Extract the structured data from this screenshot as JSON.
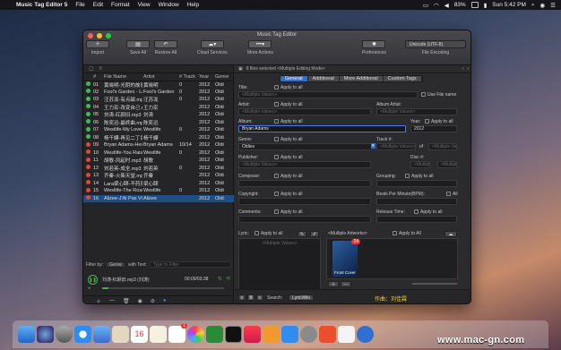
{
  "menubar": {
    "apple": "",
    "app": "Music Tag Editor 5",
    "menus": [
      "File",
      "Edit",
      "Format",
      "View",
      "Window",
      "Help"
    ],
    "battery": "83%",
    "time": "Sun 5:42 PM"
  },
  "window": {
    "title": "Music Tag Editor",
    "toolbar": [
      {
        "icon": "plus-icon",
        "label": "Import"
      },
      {
        "icon": "save-icon",
        "label": "Save All"
      },
      {
        "icon": "restore-icon",
        "label": "Restore All"
      },
      {
        "icon": "cloud-icon",
        "label": "Cloud Services"
      },
      {
        "icon": "more-icon",
        "label": "More Actions"
      },
      {
        "icon": "gear-icon",
        "label": "Preferences"
      }
    ],
    "encoding": {
      "value": "Unicode (UTF-8)",
      "label": "File Encoding"
    }
  },
  "files": {
    "columns": [
      "#",
      "File Name",
      "Artist",
      "# Track",
      "Year",
      "Genre"
    ],
    "rows": [
      [
        "01",
        "黄晓明-光阴的故事.",
        "黄晓明",
        "0",
        "2012",
        "Oldi",
        "#3bbf5a"
      ],
      [
        "02",
        "Fool's Garden - Le.",
        "Fool's Garden",
        "0",
        "2012",
        "Oldi",
        "#3bbf5a"
      ],
      [
        "03",
        "汪苏泷-有点甜.mp3",
        "汪苏泷",
        "0",
        "2012",
        "Oldi",
        "#3bbf5a"
      ],
      [
        "04",
        "王力宏-改变自己.mp",
        "王力宏",
        "",
        "2012",
        "Oldi",
        "#3bbf5a"
      ],
      [
        "05",
        "刘涛-红颜旧.mp3",
        "刘涛",
        "",
        "2012",
        "Oldi",
        "#3bbf5a"
      ],
      [
        "06",
        "陈奕迅-最终曲.mp3",
        "陈奕迅",
        "",
        "2012",
        "Oldi",
        "#3bbf5a"
      ],
      [
        "07",
        "Westlife-My Love.m",
        "Westlife",
        "0",
        "2012",
        "Oldi",
        "#3bbf5a"
      ],
      [
        "08",
        "杨千嬅-再见二丁目",
        "杨千嬅",
        "",
        "2012",
        "Oldi",
        "#3bbf5a"
      ],
      [
        "09",
        "Bryan Adams-Hea.",
        "Bryan Adams",
        "10/14",
        "2012",
        "Oldi",
        "#e0463e"
      ],
      [
        "10",
        "Westlife-You Raise.",
        "Westlife",
        "0",
        "2012",
        "Oldi",
        "#e0463e"
      ],
      [
        "11",
        "胡歌-风起时.mp3",
        "胡歌",
        "",
        "2012",
        "Oldi",
        "#e0463e"
      ],
      [
        "12",
        "刘若英-成全.mp3",
        "刘若英",
        "0",
        "2012",
        "Oldi",
        "#e0463e"
      ],
      [
        "13",
        "齐秦-火柴天堂.mp3",
        "齐秦",
        "",
        "2012",
        "Oldi",
        "#e0463e"
      ],
      [
        "14",
        "Lara梁心颐-不药而.",
        "梁心颐",
        "",
        "2012",
        "Oldi",
        "#e0463e"
      ],
      [
        "15",
        "Westlife-The Rose.",
        "Westlife",
        "0",
        "2012",
        "Oldi",
        "#e0463e"
      ],
      [
        "16",
        "Alizee-J'Ai Pas Vi.",
        "Alizee",
        "",
        "2012",
        "Oldi",
        "#e0463e"
      ]
    ],
    "selected_row": 15
  },
  "filter": {
    "label": "Filter by:",
    "field": "Genre",
    "with": "with Text:",
    "placeholder": "Type to Filter"
  },
  "player": {
    "file": "刘涛-红颜旧.mp3 (刘涛)",
    "time": "00:09/03:38",
    "progress": 0.05
  },
  "editor": {
    "info": "8 files selected <Multiple Editing Mode>",
    "tabs": [
      "General",
      "Additional",
      "More Additional",
      "Custom Tags"
    ],
    "active_tab": "General",
    "apply": "Apply to all",
    "multi": "<Multiple Values>",
    "fields": {
      "title": "Title:",
      "use_filename": "Use File name",
      "artist": "Artist:",
      "album_artist": "Album Artist:",
      "album": "Album:",
      "album_value": "Bryan Adams",
      "year": "Year:",
      "year_value": "2012",
      "genre": "Genre:",
      "genre_value": "Oldies",
      "track": "Track #:",
      "of": "of",
      "publisher": "Publisher:",
      "disc": "Disc #:",
      "composer": "Composer:",
      "grouping": "Grouping:",
      "copyright": "Copyright:",
      "bpm": "Beats Per Minute(BPM):",
      "all": "All",
      "comments": "Comments:",
      "release": "Release Time:",
      "lyric": "Lyric:",
      "artworks": "<Multiple Artworks>",
      "apply_all": "Apply to All",
      "artwork_caption": "Front Cover",
      "artwork_count": "24",
      "search": "Search:",
      "lyric_source": "LyricWiki"
    },
    "author_label": "作曲：刘佳霖"
  },
  "dock": {
    "badges": {
      "calendar": "16",
      "reminders": "1"
    }
  },
  "watermark": "www.mac-gn.com"
}
